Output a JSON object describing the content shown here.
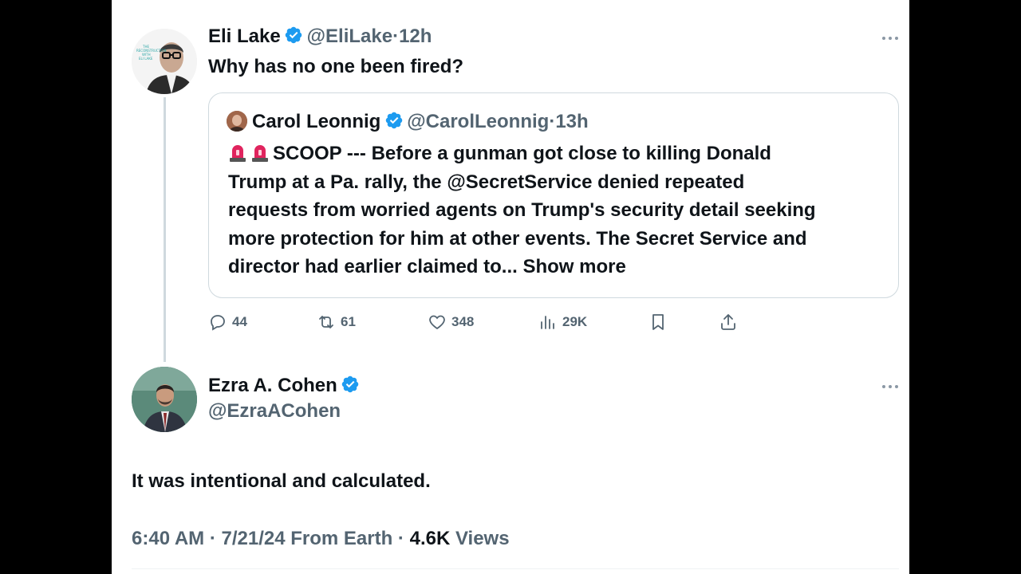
{
  "tweet": {
    "author_name": "Eli Lake",
    "author_handle": "@EliLake",
    "separator": "·",
    "time_ago": "12h",
    "text": "Why has no one been fired?",
    "avatar_caption": [
      "THE",
      "RECONSTRUCTION",
      "WITH",
      "ELI LAKE"
    ],
    "quote": {
      "author_name": "Carol Leonnig",
      "author_handle": "@CarolLeonnig",
      "time_ago": "13h",
      "lines": [
        "SCOOP --- Before a gunman got close to killing Donald",
        "Trump at a Pa. rally, the @SecretService denied repeated",
        "requests from worried agents on Trump's  security detail seeking",
        "more protection for him at other events. The Secret Service and",
        "director had earlier claimed to..."
      ],
      "show_more": "Show more"
    },
    "stats": {
      "replies": "44",
      "reposts": "61",
      "likes": "348",
      "views": "29K"
    }
  },
  "reply": {
    "author_name": "Ezra A. Cohen",
    "author_handle": "@EzraACohen",
    "text": "It was intentional and calculated.",
    "footer": {
      "time": "6:40 AM",
      "sep1": "·",
      "date": "7/21/24",
      "location": "From Earth",
      "sep2": "·",
      "views_count": "4.6K",
      "views_label": "Views"
    }
  },
  "colors": {
    "verified": "#1d9bf0",
    "secondary_text": "#536471",
    "primary_text": "#0f1419",
    "border": "#cfd9de",
    "siren": "#e0245e"
  },
  "icons": [
    "verified-badge-icon",
    "more-icon",
    "reply-icon",
    "repost-icon",
    "like-icon",
    "views-icon",
    "bookmark-icon",
    "share-icon",
    "siren-icon"
  ]
}
